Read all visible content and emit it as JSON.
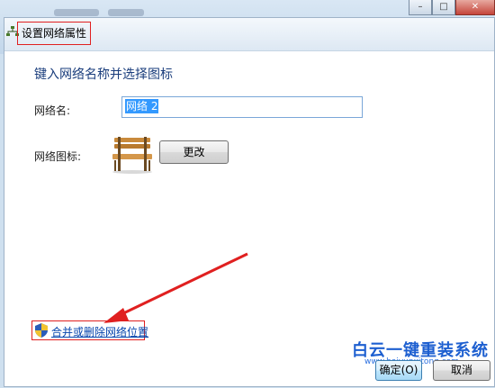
{
  "window": {
    "title": "设置网络属性",
    "caption_buttons": [
      "–",
      "□",
      "✕"
    ]
  },
  "heading": "键入网络名称并选择图标",
  "network_name": {
    "label": "网络名:",
    "value": "网络 2"
  },
  "network_icon": {
    "label": "网络图标:",
    "icon": "bench-icon",
    "change_label": "更改"
  },
  "merge_link": {
    "icon": "uac-shield-icon",
    "label": "合并或删除网络位置"
  },
  "buttons": {
    "ok": "确定(O)",
    "cancel": "取消"
  },
  "watermark": {
    "text": "白云一键重装系统",
    "url": "www.baiyunxitong.com"
  },
  "colors": {
    "highlight_box": "#e02020",
    "link": "#0645ad",
    "heading": "#1a3d7c"
  }
}
